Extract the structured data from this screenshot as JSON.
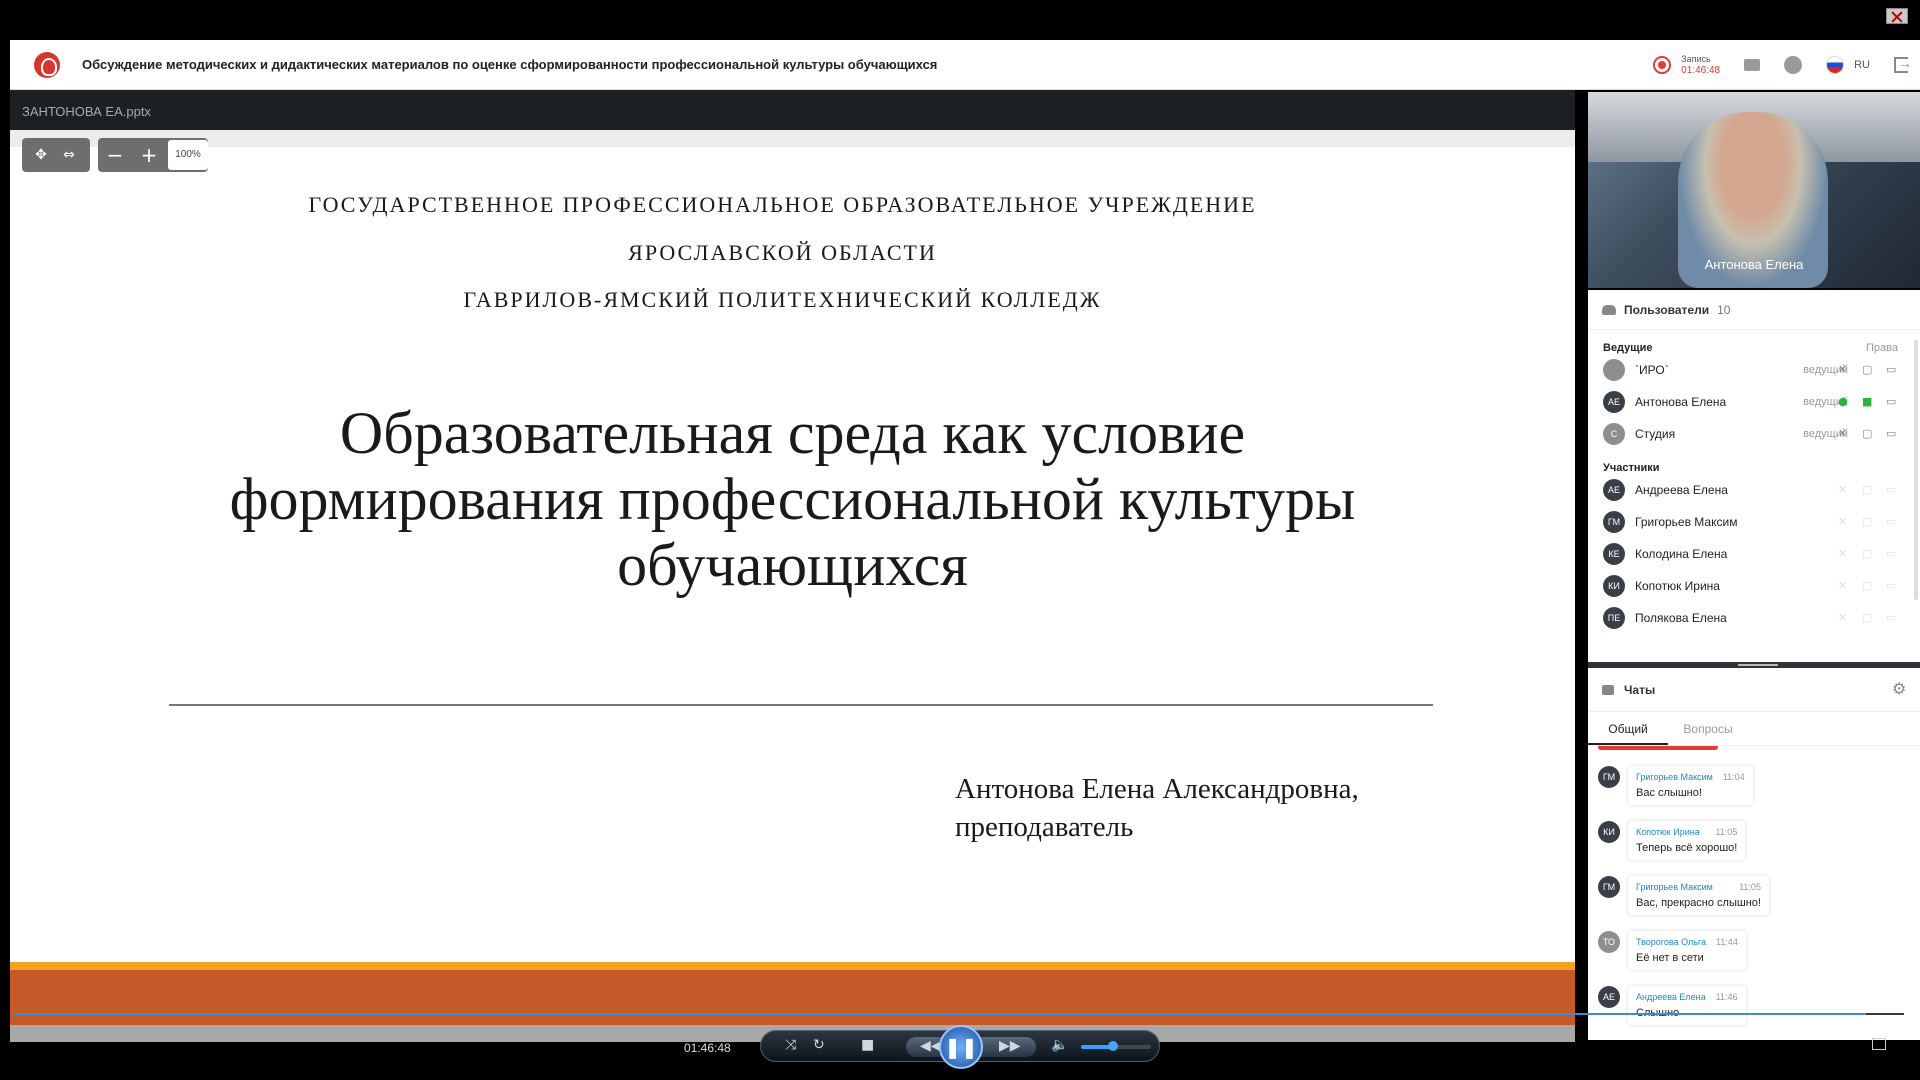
{
  "window": {
    "close_icon": "close-icon"
  },
  "header": {
    "title": "Обсуждение методических и дидактических материалов по оценке сформированности профессиональной культуры обучающихся",
    "record_label": "Запись",
    "record_time": "01:46:48",
    "lang": "RU",
    "icons": [
      "folder-icon",
      "info-icon",
      "flag-icon",
      "exit-icon"
    ]
  },
  "presentation": {
    "file_name": "ЗАНТОНОВА ЕА.pptx",
    "zoom": "100%",
    "zoom_minus": "−",
    "zoom_plus": "+",
    "slide": {
      "org_line1": "ГОСУДАРСТВЕННОЕ ПРОФЕССИОНАЛЬНОЕ ОБРАЗОВАТЕЛЬНОЕ УЧРЕЖДЕНИЕ",
      "org_line2": "ЯРОСЛАВСКОЙ ОБЛАСТИ",
      "org_line3": "ГАВРИЛОВ-ЯМСКИЙ ПОЛИТЕХНИЧЕСКИЙ КОЛЛЕДЖ",
      "title_line1": "Образовательная среда как условие",
      "title_line2": "формирования профессиональной культуры",
      "title_line3": "обучающихся",
      "author_line1": "Антонова Елена Александровна,",
      "author_line2": "преподаватель"
    }
  },
  "video": {
    "name": "Антонова Елена"
  },
  "users": {
    "title": "Пользователи",
    "count": "10",
    "hosts_label": "Ведущие",
    "rights_label": "Права",
    "role_label": "ведущий",
    "hosts": [
      {
        "initials": "",
        "name": "`ИРО`"
      },
      {
        "initials": "АЕ",
        "name": "Антонова Елена"
      },
      {
        "initials": "С",
        "name": "Студия"
      }
    ],
    "participants_label": "Участники",
    "participants": [
      {
        "initials": "АЕ",
        "name": "Андреева Елена"
      },
      {
        "initials": "ГМ",
        "name": "Григорьев Максим"
      },
      {
        "initials": "КЕ",
        "name": "Колодина Елена"
      },
      {
        "initials": "КИ",
        "name": "Копотюк Ирина"
      },
      {
        "initials": "ПЕ",
        "name": "Полякова Елена"
      }
    ]
  },
  "chat": {
    "title": "Чаты",
    "tabs": [
      "Общий",
      "Вопросы"
    ],
    "messages": [
      {
        "initials": "ГМ",
        "author": "Григорьев Максим",
        "time": "11:04",
        "text": "Вас слышно!"
      },
      {
        "initials": "КИ",
        "author": "Копотюк Ирина",
        "time": "11:05",
        "text": "Теперь всё хорошо!"
      },
      {
        "initials": "ГМ",
        "author": "Григорьев Максим",
        "time": "11:05",
        "text": "Вас, прекрасно слышно!"
      },
      {
        "initials": "ТО",
        "author": "Творогова Ольга",
        "time": "11:44",
        "text": "Её нет в сети"
      },
      {
        "initials": "АЕ",
        "author": "Андреева Елена",
        "time": "11:46",
        "text": "Слышно"
      }
    ]
  },
  "player": {
    "time": "01:46:48",
    "progress": 0.98,
    "volume": 0.45
  }
}
